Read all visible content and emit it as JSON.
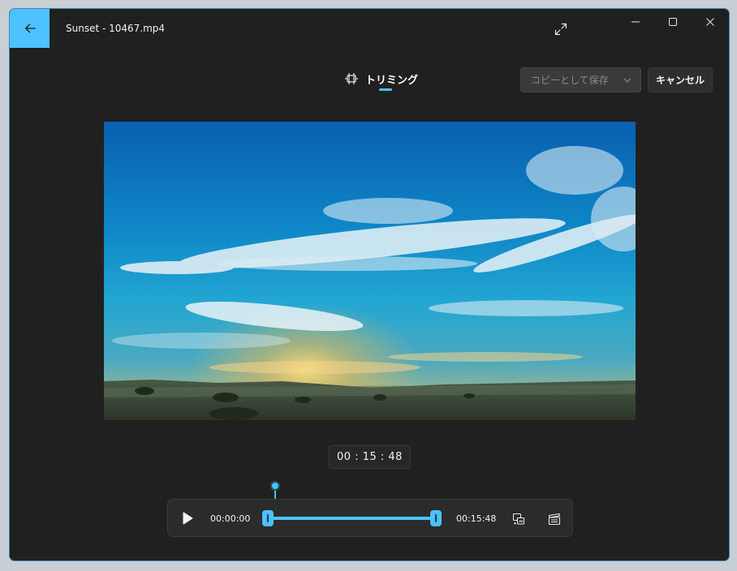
{
  "window": {
    "title": "Sunset - 10467.mp4"
  },
  "toolbar": {
    "trim_tab_label": "トリミング",
    "save_button_label": "コピーとして保存",
    "cancel_button_label": "キャンセル"
  },
  "player": {
    "current_time": "00 : 15 : 48",
    "start_time": "00:00:00",
    "end_time": "00:15:48"
  },
  "icons": {
    "back": "arrow-left-icon",
    "expand": "expand-icon",
    "minimize": "minimize-icon",
    "maximize": "maximize-icon",
    "close": "close-icon",
    "trim": "trim-icon",
    "dropdown": "chevron-down-icon",
    "play": "play-icon",
    "snapshot": "save-frame-icon",
    "clapper": "clapperboard-icon"
  },
  "colors": {
    "accent": "#4cc2ff",
    "background": "#202020",
    "surface": "#2b2b2b"
  }
}
